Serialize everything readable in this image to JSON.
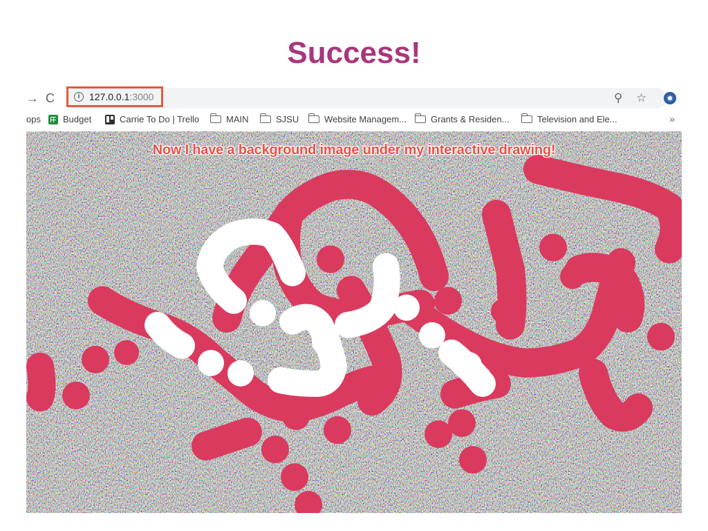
{
  "slide": {
    "title": "Success!"
  },
  "browser": {
    "back_glyph": "→",
    "reload_glyph": "C",
    "url_host": "127.0.0.1",
    "url_port": ":3000",
    "zoom_glyph": "⚲",
    "star_glyph": "☆"
  },
  "bookmarks": {
    "items": [
      {
        "label": "ops",
        "icon": "none"
      },
      {
        "label": "Budget",
        "icon": "sheets-icon"
      },
      {
        "label": "Carrie To Do | Trello",
        "icon": "trello-icon"
      },
      {
        "label": "MAIN",
        "icon": "folder-icon"
      },
      {
        "label": "SJSU",
        "icon": "folder-icon"
      },
      {
        "label": "Website Managem...",
        "icon": "folder-icon"
      },
      {
        "label": "Grants & Residen...",
        "icon": "folder-icon"
      },
      {
        "label": "Television and Ele...",
        "icon": "folder-icon"
      }
    ],
    "more_glyph": "»"
  },
  "canvas": {
    "caption": "Now I have a background image under my interactive drawing!",
    "stroke_colors": {
      "pink": "#d93a5e",
      "white": "#ffffff"
    }
  }
}
